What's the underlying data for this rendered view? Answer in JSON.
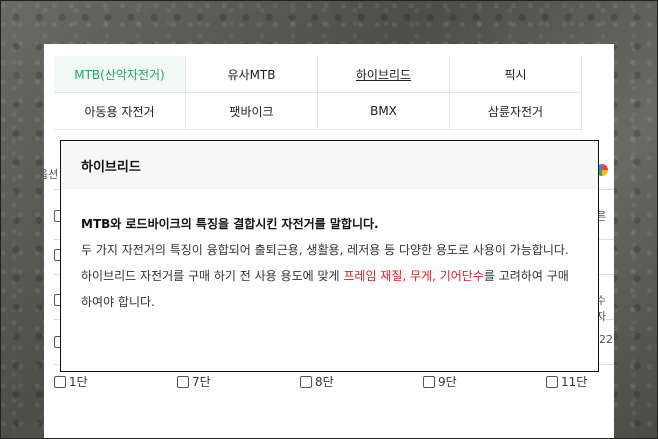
{
  "tabs": {
    "row1": [
      "MTB(산악자전거)",
      "유사MTB",
      "하이브리드",
      "픽시"
    ],
    "row2": [
      "아동용 자전거",
      "팻바이크",
      "BMX",
      "삼륜자전거"
    ]
  },
  "background": {
    "left_label": "옵션",
    "right_top": "른",
    "right_mid": "수자",
    "right_low": "22"
  },
  "filters": [
    "1단",
    "7단",
    "8단",
    "9단",
    "11단"
  ],
  "popup": {
    "title": "하이브리드",
    "lead": "MTB와 로드바이크의 특징을 결합시킨 자전거를 말합니다.",
    "text_before": "두 가지 자전거의 특징이 융합되어 출퇴근용, 생활용, 레저용 등 다양한 용도로 사용이 가능합니다. 하이브리드 자전거를 구매 하기 전 사용 용도에 맞게 ",
    "highlight": "프레임 재질, 무게, 기어단수",
    "text_after": "를 고려하여 구매하여야 합니다."
  },
  "colors": {
    "active_tab": "#1fa36b",
    "highlight": "#e51c23"
  }
}
